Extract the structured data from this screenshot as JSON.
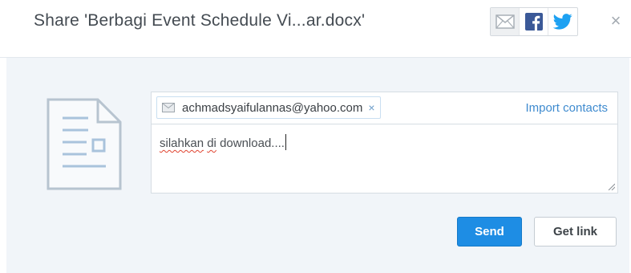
{
  "dialog": {
    "title": "Share 'Berbagi Event Schedule Vi...ar.docx'",
    "close_label": "×"
  },
  "share_options": [
    {
      "name": "email",
      "icon": "mail-icon",
      "active": true
    },
    {
      "name": "facebook",
      "icon": "facebook-icon",
      "active": false
    },
    {
      "name": "twitter",
      "icon": "twitter-icon",
      "active": false
    }
  ],
  "recipients": {
    "chips": [
      {
        "email": "achmadsyaifulannas@yahoo.com",
        "remove_label": "×"
      }
    ],
    "import_label": "Import contacts"
  },
  "message": {
    "word1": "silahkan",
    "word2": "di",
    "rest": " download...."
  },
  "buttons": {
    "send_label": "Send",
    "get_link_label": "Get link"
  },
  "colors": {
    "primary": "#1e8de4",
    "link": "#3f8bcf",
    "panel_bg": "#f1f5f9",
    "facebook": "#3b5998",
    "twitter": "#1da1f2"
  }
}
